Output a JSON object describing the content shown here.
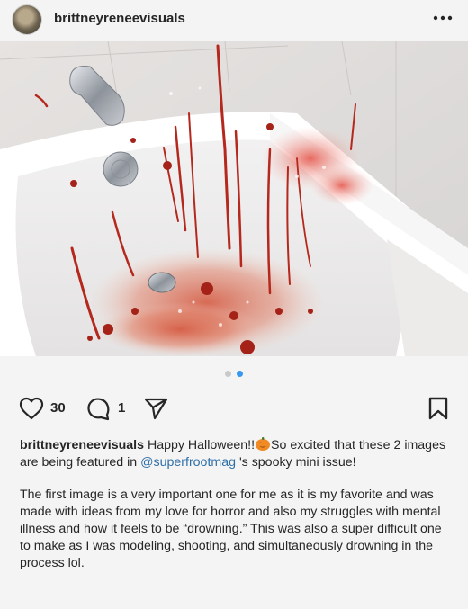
{
  "post": {
    "username": "brittneyreneevisuals",
    "likes": "30",
    "comments": "1",
    "carousel_total": 2,
    "carousel_active": 2
  },
  "caption": {
    "username": "brittneyreneevisuals",
    "text1_a": "Happy Halloween!!",
    "emoji_name": "jack-o-lantern",
    "text1_b": "So excited that these 2 images are being featured in",
    "mention": "@superfrootmag",
    "text1_c": "'s spooky mini issue!",
    "paragraph2": "The first image is a very important one for me as it is my favorite and was made with ideas from my love for horror and also my struggles with mental illness and how it feels to be “drowning.” This was also a super difficult one to make as I was modeling, shooting, and simultaneously drowning in the process lol."
  },
  "icons": {
    "like": "heart-icon",
    "comment": "comment-icon",
    "share": "paper-plane-icon",
    "save": "bookmark-icon",
    "more": "more-horizontal-icon"
  },
  "colors": {
    "mention": "#2f6fa8",
    "active_dot": "#3897f0",
    "blood": "#b5281d"
  }
}
